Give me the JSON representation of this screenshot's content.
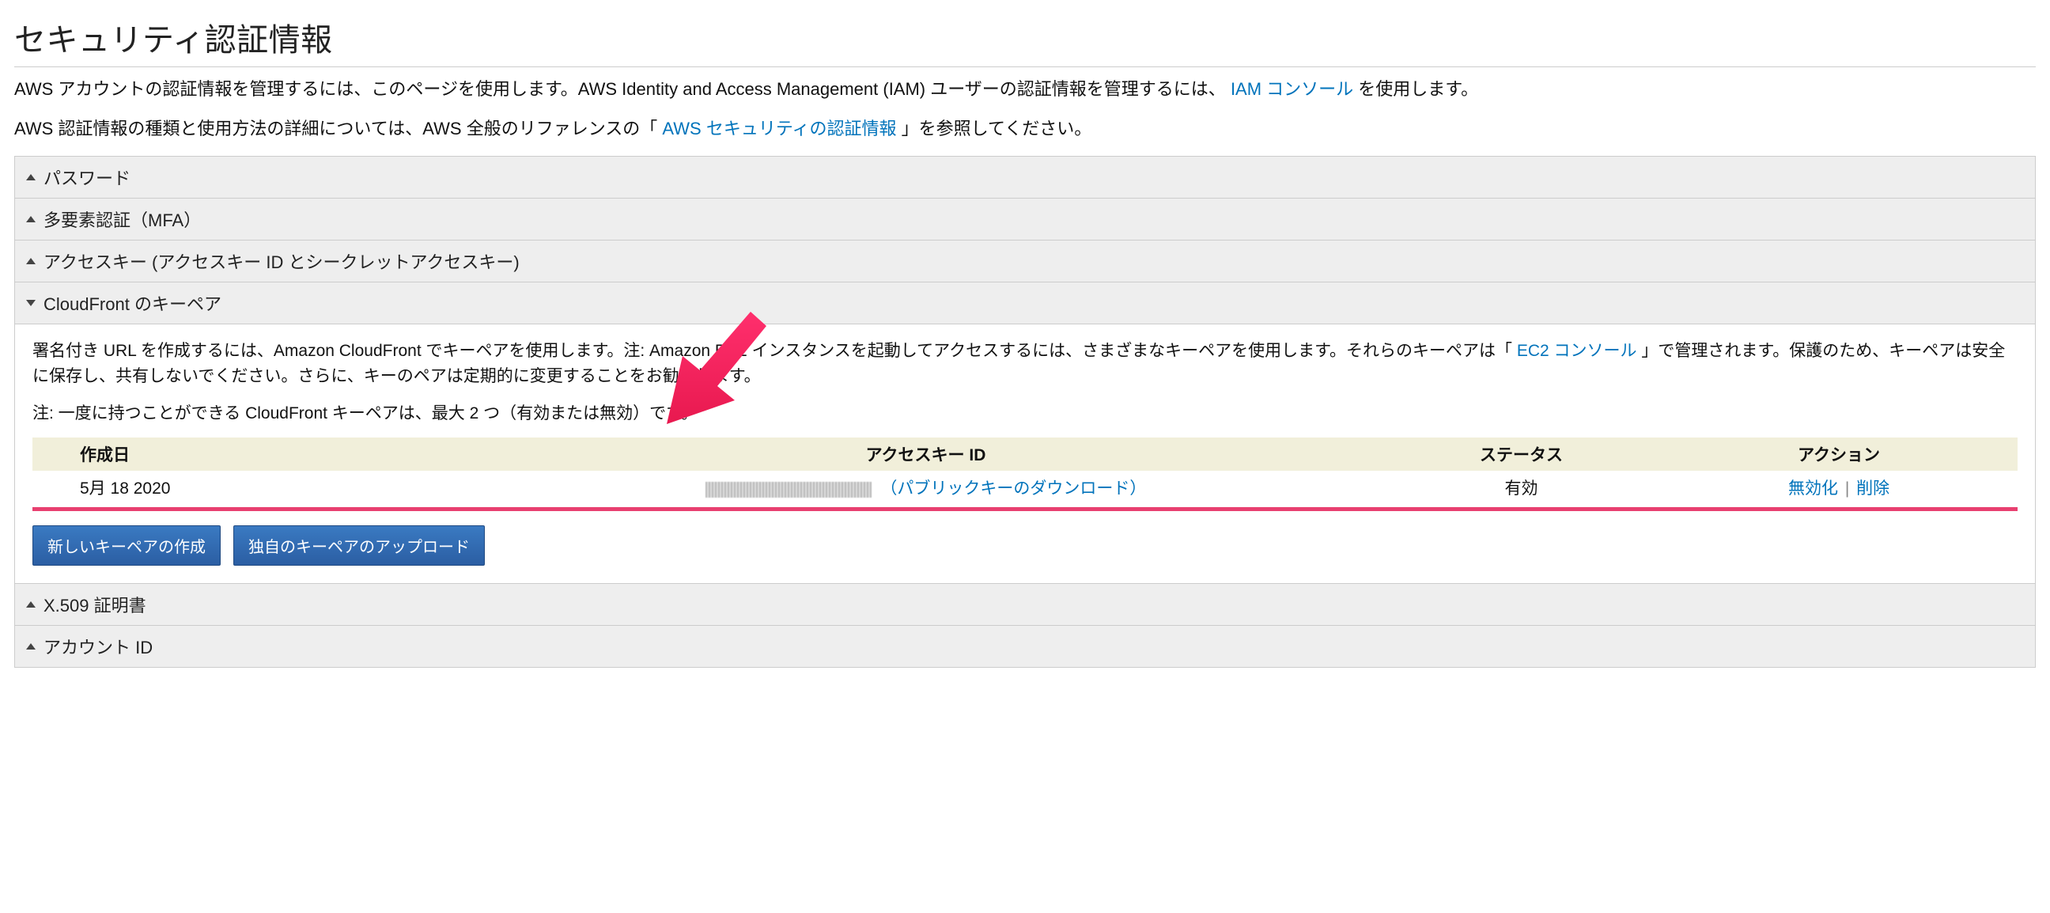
{
  "page_title": "セキュリティ認証情報",
  "intro": {
    "p1_a": "AWS アカウントの認証情報を管理するには、このページを使用します。AWS Identity and Access Management (IAM) ユーザーの認証情報を管理するには、 ",
    "p1_link": "IAM コンソール",
    "p1_b": " を使用します。",
    "p2_a": "AWS 認証情報の種類と使用方法の詳細については、AWS 全般のリファレンスの「 ",
    "p2_link": "AWS セキュリティの認証情報",
    "p2_b": " 」を参照してください。"
  },
  "accordion": {
    "password": {
      "label": "パスワード"
    },
    "mfa": {
      "label": "多要素認証（MFA）"
    },
    "access_keys": {
      "label": "アクセスキー (アクセスキー ID とシークレットアクセスキー)"
    },
    "cloudfront": {
      "label": "CloudFront のキーペア",
      "desc_p1_a": "署名付き URL を作成するには、Amazon CloudFront でキーペアを使用します。注: Amazon EC2 インスタンスを起動してアクセスするには、さまざまなキーペアを使用します。それらのキーペアは「 ",
      "desc_p1_link": "EC2 コンソール",
      "desc_p1_b": " 」で管理されます。保護のため、キーペアは安全に保存し、共有しないでください。さらに、キーのペアは定期的に変更することをお勧めします。",
      "desc_p2": "注: 一度に持つことができる CloudFront キーペアは、最大 2 つ（有効または無効）です。",
      "table": {
        "headers": {
          "created": "作成日",
          "access_key_id": "アクセスキー ID",
          "status": "ステータス",
          "action": "アクション"
        },
        "row": {
          "created": "5月 18 2020",
          "download_link": "（パブリックキーのダウンロード）",
          "status": "有効",
          "action_disable": "無効化",
          "action_sep": " | ",
          "action_delete": "削除"
        }
      },
      "buttons": {
        "create": "新しいキーペアの作成",
        "upload": "独自のキーペアのアップロード"
      }
    },
    "x509": {
      "label": "X.509 証明書"
    },
    "account_id": {
      "label": "アカウント ID"
    }
  }
}
